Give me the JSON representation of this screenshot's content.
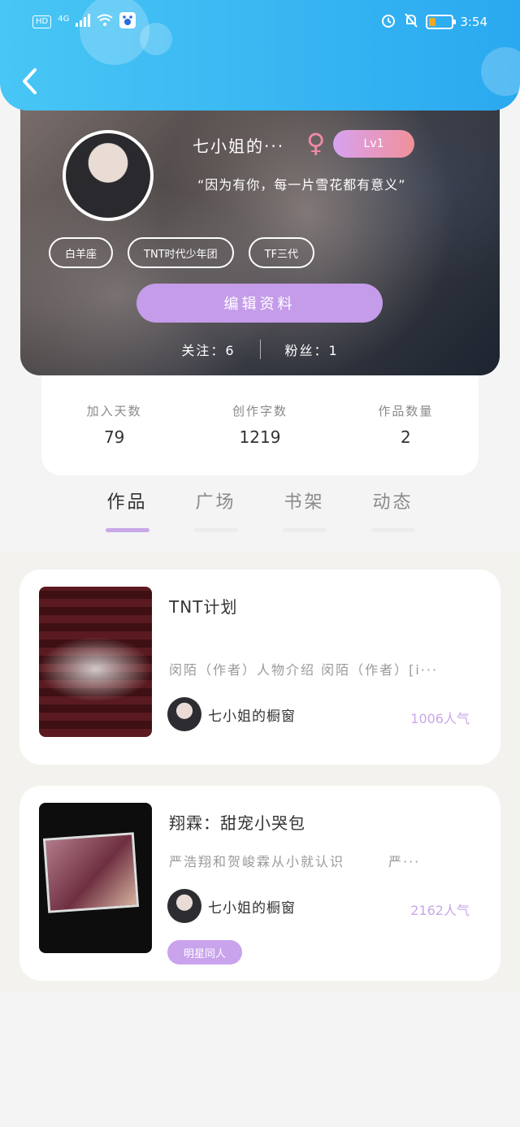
{
  "status_bar": {
    "hd": "HD",
    "network": "4G",
    "time": "3:54"
  },
  "profile": {
    "nickname": "七小姐的···",
    "gender_symbol": "♀",
    "level": "Lv1",
    "motto": "“因为有你，每一片雪花都有意义”",
    "tags": [
      "白羊座",
      "TNT时代少年团",
      "TF三代"
    ],
    "edit_button": "编辑资料",
    "following": "关注：6",
    "followers": "粉丝：1"
  },
  "stats": [
    {
      "label": "加入天数",
      "value": "79"
    },
    {
      "label": "创作字数",
      "value": "1219"
    },
    {
      "label": "作品数量",
      "value": "2"
    }
  ],
  "tabs": [
    {
      "label": "作品",
      "active": true
    },
    {
      "label": "广场",
      "active": false
    },
    {
      "label": "书架",
      "active": false
    },
    {
      "label": "动态",
      "active": false
    }
  ],
  "works": [
    {
      "title": "TNT计划",
      "description": "闵陌（作者）人物介绍 闵陌（作者）[i···",
      "author": "七小姐的橱窗",
      "popularity": "1006人气"
    },
    {
      "title": "翔霖：甜宠小哭包",
      "description": "严浩翔和贺峻霖从小就认识　　　严···",
      "author": "七小姐的橱窗",
      "popularity": "2162人气",
      "genre": "明星同人"
    }
  ],
  "colors": {
    "header": "#2aa9f0",
    "accent": "#c59cea",
    "level_gradient": "#f1909a"
  }
}
